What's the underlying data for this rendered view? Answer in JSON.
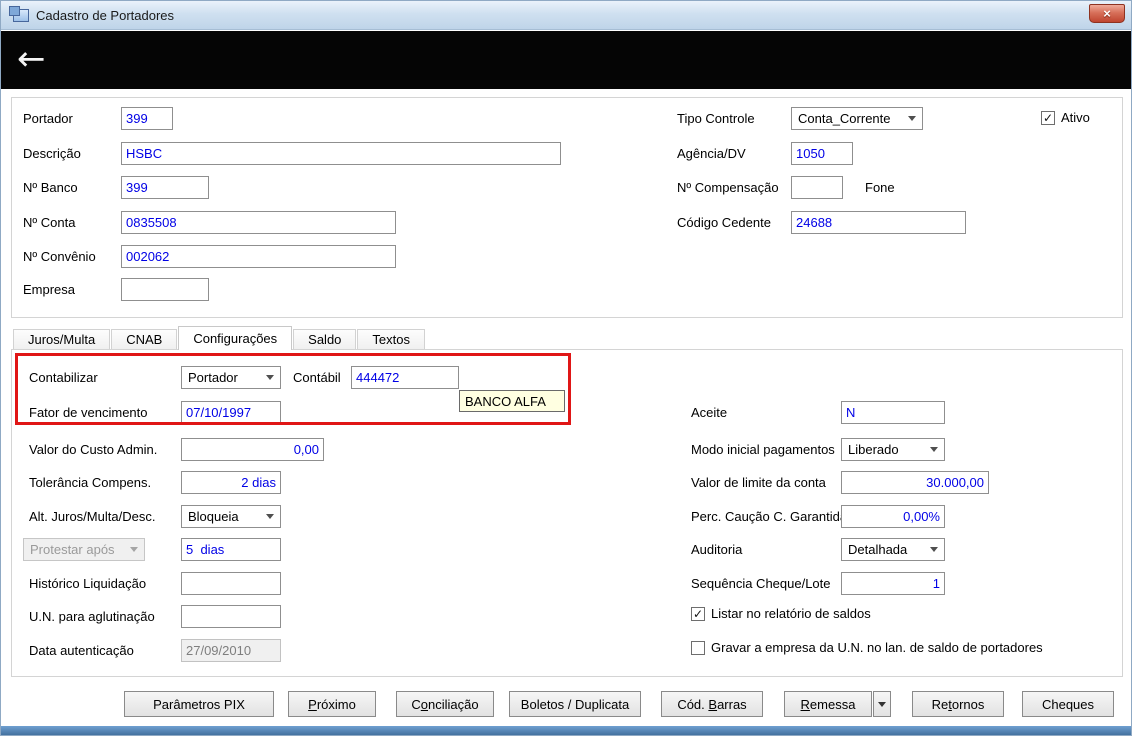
{
  "window": {
    "title": "Cadastro de Portadores",
    "close_icon": "×"
  },
  "header": {
    "back_icon": "←"
  },
  "top_form": {
    "portador": {
      "label": "Portador",
      "value": "399"
    },
    "descricao": {
      "label": "Descrição",
      "value": "HSBC"
    },
    "n_banco": {
      "label": "Nº Banco",
      "value": "399"
    },
    "n_conta": {
      "label": "Nº Conta",
      "value": "0835508"
    },
    "n_convenio": {
      "label": "Nº Convênio",
      "value": "002062"
    },
    "empresa": {
      "label": "Empresa",
      "value": ""
    },
    "tipo_controle": {
      "label": "Tipo Controle",
      "value": "Conta_Corrente"
    },
    "agencia_dv": {
      "label": "Agência/DV",
      "value": "1050"
    },
    "n_compensacao": {
      "label": "Nº Compensação",
      "value": "",
      "suffix_label": "Fone"
    },
    "codigo_cedente": {
      "label": "Código Cedente",
      "value": "24688"
    },
    "ativo": {
      "label": "Ativo",
      "checked": true
    }
  },
  "tabs": {
    "items": [
      {
        "label": "Juros/Multa",
        "active": false
      },
      {
        "label": "CNAB",
        "active": false
      },
      {
        "label": "Configurações",
        "active": true
      },
      {
        "label": "Saldo",
        "active": false
      },
      {
        "label": "Textos",
        "active": false
      }
    ]
  },
  "config": {
    "contabilizar": {
      "label": "Contabilizar",
      "value": "Portador"
    },
    "contabil": {
      "label": "Contábil",
      "value": "444472"
    },
    "tooltip": {
      "text": "BANCO ALFA"
    },
    "fator_vencimento": {
      "label": "Fator de vencimento",
      "value": "07/10/1997"
    },
    "custo_admin": {
      "label": "Valor do Custo Admin.",
      "value": "0,00"
    },
    "tolerancia": {
      "label": "Tolerância Compens.",
      "value": "2 dias"
    },
    "alt_juros": {
      "label": "Alt. Juros/Multa/Desc.",
      "value": "Bloqueia"
    },
    "protestar": {
      "label": "Protestar após",
      "value": "5  dias"
    },
    "historico_liquidacao": {
      "label": "Histórico Liquidação",
      "value": ""
    },
    "un_aglutinacao": {
      "label": "U.N. para aglutinação",
      "value": ""
    },
    "data_autenticacao": {
      "label": "Data autenticação",
      "value": "27/09/2010"
    },
    "aceite": {
      "label": "Aceite",
      "value": "N"
    },
    "modo_inicial": {
      "label": "Modo inicial pagamentos",
      "value": "Liberado"
    },
    "limite_conta": {
      "label": "Valor de limite da conta",
      "value": "30.000,00"
    },
    "caucao": {
      "label": "Perc. Caução C. Garantida",
      "value": "0,00%"
    },
    "auditoria": {
      "label": "Auditoria",
      "value": "Detalhada"
    },
    "seq_cheque_lote": {
      "label": "Sequência Cheque/Lote",
      "value": "1"
    },
    "listar_saldos": {
      "label": "Listar no relatório de saldos",
      "checked": true
    },
    "gravar_empresa": {
      "label": "Gravar a empresa da U.N. no lan. de saldo de portadores",
      "checked": false
    }
  },
  "footer_buttons": {
    "parametros_pix": {
      "pre": "Parâmetros PIX",
      "key": "",
      "post": ""
    },
    "proximo": {
      "pre": "",
      "key": "P",
      "post": "róximo"
    },
    "conciliacao": {
      "pre": "C",
      "key": "o",
      "post": "nciliação"
    },
    "boletos_duplicata": {
      "pre": "Boletos / Duplicata",
      "key": "",
      "post": ""
    },
    "cod_barras": {
      "pre": "Cód. ",
      "key": "B",
      "post": "arras"
    },
    "remessa": {
      "pre": "",
      "key": "R",
      "post": "emessa"
    },
    "retornos": {
      "pre": "Re",
      "key": "t",
      "post": "ornos"
    },
    "cheques": {
      "pre": "Cheques",
      "key": "",
      "post": ""
    }
  }
}
